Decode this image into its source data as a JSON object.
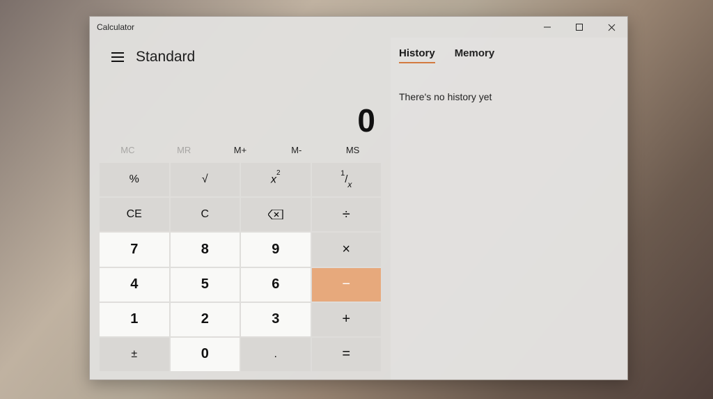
{
  "window": {
    "title": "Calculator"
  },
  "mode": {
    "label": "Standard"
  },
  "display": {
    "value": "0"
  },
  "memory": {
    "mc": "MC",
    "mr": "MR",
    "mplus": "M+",
    "mminus": "M-",
    "ms": "MS"
  },
  "keys": {
    "percent": "%",
    "sqrt": "√",
    "square_base": "x",
    "square_exp": "2",
    "recip_num": "1",
    "recip_sep": "/",
    "recip_den": "x",
    "ce": "CE",
    "c": "C",
    "divide": "÷",
    "n7": "7",
    "n8": "8",
    "n9": "9",
    "mult": "×",
    "n4": "4",
    "n5": "5",
    "n6": "6",
    "minus": "−",
    "n1": "1",
    "n2": "2",
    "n3": "3",
    "plus": "+",
    "pm": "±",
    "n0": "0",
    "dot": ".",
    "eq": "="
  },
  "tabs": {
    "history": "History",
    "memory": "Memory"
  },
  "panel": {
    "empty_history": "There's no history yet"
  }
}
